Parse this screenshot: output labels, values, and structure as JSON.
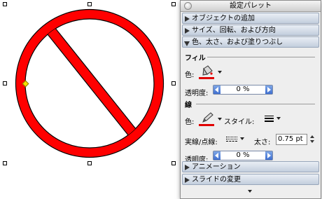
{
  "palette": {
    "title": "設定パレット",
    "sections": {
      "object_add": "オブジェクトの追加",
      "size_rotate": "サイズ、回転、および方向",
      "color_stroke_fill": "色、太さ、および塗りつぶし",
      "animation": "アニメーション",
      "slide_change": "スライドの変更"
    },
    "fill": {
      "group": "フィル",
      "color_label": "色:",
      "opacity_label": "透明度:",
      "opacity_value": "0 %"
    },
    "line": {
      "group": "線",
      "color_label": "色:",
      "style_label": "スタイル:",
      "dash_label": "実線/点線:",
      "thickness_label": "太さ:",
      "thickness_value": "0.75 pt",
      "opacity_label": "透明度:",
      "opacity_value": "0 %"
    }
  },
  "colors": {
    "shape_fill": "#ff0000",
    "fill_swatch": "#e00000",
    "line_swatch": "#e00000"
  }
}
